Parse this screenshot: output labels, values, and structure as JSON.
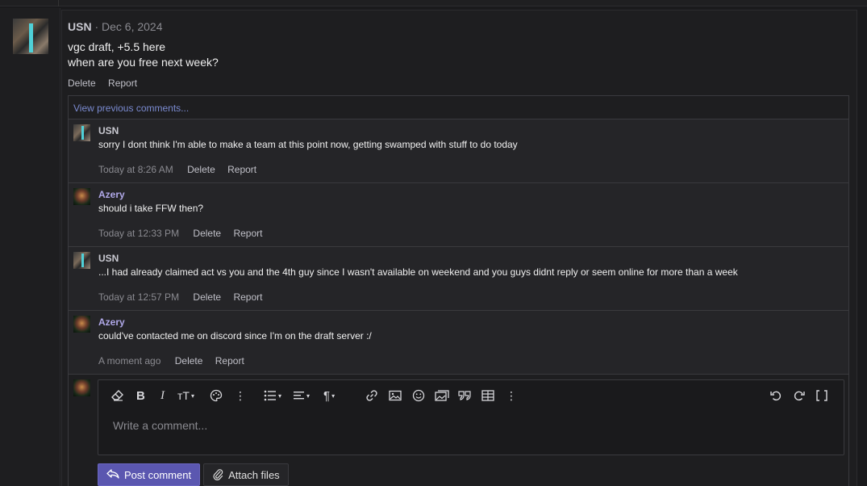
{
  "post": {
    "author": "USN",
    "date": "· Dec 6, 2024",
    "lines": [
      "vgc draft, +5.5 here",
      "when are you free next week?"
    ],
    "actions": {
      "delete": "Delete",
      "report": "Report"
    }
  },
  "comments_section": {
    "view_previous": "View previous comments...",
    "comments": [
      {
        "author": "USN",
        "text": "sorry I dont think I'm able to make a team at this point now, getting swamped with stuff to do today",
        "time": "Today at 8:26 AM",
        "delete": "Delete",
        "report": "Report"
      },
      {
        "author": "Azery",
        "text": "should i take FFW then?",
        "time": "Today at 12:33 PM",
        "delete": "Delete",
        "report": "Report"
      },
      {
        "author": "USN",
        "text": "...I had already claimed act vs you and the 4th guy since I wasn't available on weekend and you guys didnt reply or seem online for more than a week",
        "time": "Today at 12:57 PM",
        "delete": "Delete",
        "report": "Report"
      },
      {
        "author": "Azery",
        "text": "could've contacted me on discord since I'm on the draft server :/",
        "time": "A moment ago",
        "delete": "Delete",
        "report": "Report"
      }
    ]
  },
  "editor": {
    "placeholder": "Write a comment...",
    "toolbar_icons": [
      "eraser-icon",
      "bold-icon",
      "italic-icon",
      "text-size-icon",
      "palette-icon",
      "more-icon",
      "list-icon",
      "align-icon",
      "paragraph-icon",
      "link-icon",
      "image-icon",
      "emoji-icon",
      "media-icon",
      "quote-icon",
      "table-icon",
      "more-icon",
      "undo-icon",
      "redo-icon",
      "fullscreen-icon"
    ]
  },
  "buttons": {
    "post_comment": "Post comment",
    "attach_files": "Attach files"
  },
  "colors": {
    "accent": "#5b57b0",
    "link": "#7a8ad0",
    "azery_name": "#b0a8e8"
  }
}
